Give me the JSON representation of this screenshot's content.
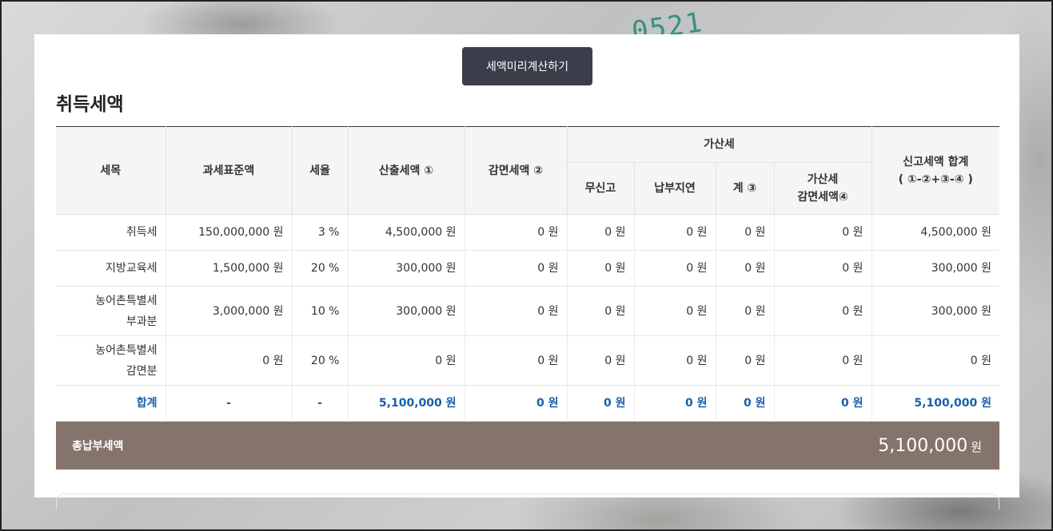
{
  "calc_button": "세액미리계산하기",
  "section_title": "취득세액",
  "headers": {
    "item": "세목",
    "base": "과세표준액",
    "rate": "세율",
    "calc_tax": "산출세액 ①",
    "reduction": "감면세액 ②",
    "penalty_group": "가산세",
    "no_report": "무신고",
    "late_payment": "납부지연",
    "subtotal": "계 ③",
    "penalty_reduction_line1": "가산세",
    "penalty_reduction_line2": "감면세액④",
    "total_line1": "신고세액 합계",
    "total_line2": "( ①-②+③-④ )"
  },
  "rows": [
    {
      "item": [
        "취득세"
      ],
      "base": "150,000,000 원",
      "rate": "3 %",
      "calc_tax": "4,500,000 원",
      "reduction": "0 원",
      "no_report": "0 원",
      "late_payment": "0 원",
      "subtotal": "0 원",
      "penalty_reduction": "0 원",
      "total": "4,500,000 원"
    },
    {
      "item": [
        "지방교육세"
      ],
      "base": "1,500,000 원",
      "rate": "20 %",
      "calc_tax": "300,000 원",
      "reduction": "0 원",
      "no_report": "0 원",
      "late_payment": "0 원",
      "subtotal": "0 원",
      "penalty_reduction": "0 원",
      "total": "300,000 원"
    },
    {
      "item": [
        "농어촌특별세",
        "부과분"
      ],
      "base": "3,000,000 원",
      "rate": "10 %",
      "calc_tax": "300,000 원",
      "reduction": "0 원",
      "no_report": "0 원",
      "late_payment": "0 원",
      "subtotal": "0 원",
      "penalty_reduction": "0 원",
      "total": "300,000 원"
    },
    {
      "item": [
        "농어촌특별세",
        "감면분"
      ],
      "base": "0 원",
      "rate": "20 %",
      "calc_tax": "0 원",
      "reduction": "0 원",
      "no_report": "0 원",
      "late_payment": "0 원",
      "subtotal": "0 원",
      "penalty_reduction": "0 원",
      "total": "0 원"
    }
  ],
  "total_row": {
    "label": "합계",
    "base": "-",
    "rate": "-",
    "calc_tax": "5,100,000 원",
    "reduction": "0 원",
    "no_report": "0 원",
    "late_payment": "0 원",
    "subtotal": "0 원",
    "penalty_reduction": "0 원",
    "total": "5,100,000 원"
  },
  "grand_total": {
    "label": "총납부세액",
    "value": "5,100,000",
    "unit": "원"
  },
  "background_scribble": "0521",
  "colors": {
    "button_bg": "#3a3d4a",
    "total_text": "#1b5faa",
    "grand_bar": "#85746c"
  }
}
